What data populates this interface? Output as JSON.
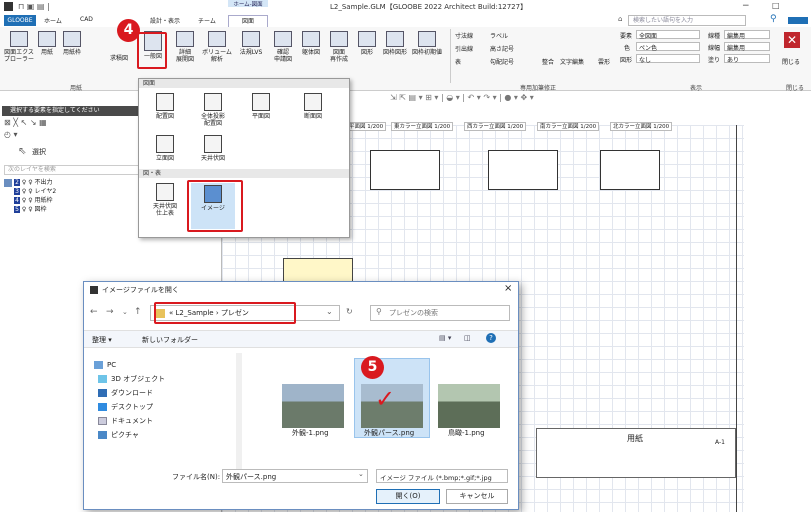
{
  "app": {
    "title": "L2_Sample.GLM【GLOOBE 2022 Architect Build:12727】",
    "context_tab": "ホーム-図面"
  },
  "tabs": [
    "GLOOBE",
    "ホーム",
    "CAD",
    "設計・表示",
    "チーム",
    "図面"
  ],
  "search": {
    "placeholder": "検索したい語句を入力"
  },
  "ribbon": {
    "buttons": [
      "図面エクス\nプローラー",
      "用紙",
      "用紙枠",
      "求積図",
      "一般図",
      "詳細\n展開図",
      "ボリューム\n解析",
      "法規LVS",
      "確認\n申請図",
      "躯体図",
      "図面\n再作成",
      "図形",
      "図枠図形",
      "図枠初期値"
    ],
    "group_labels": {
      "paper": "用紙",
      "annotation": "専用加筆修正",
      "display": "表示",
      "close": "閉じる"
    },
    "dims": [
      "寸法線",
      "ラベル",
      "引出線",
      "高さ記号",
      "表",
      "勾配記号",
      "整合",
      "文字編集",
      "雲形"
    ],
    "props": {
      "element_label": "要素",
      "element_value": "全図面",
      "color_label": "色",
      "color_value": "ペン色",
      "frame_label": "図形",
      "frame_value": "なし",
      "line_label": "線種",
      "line_value": "編集用",
      "linewidth_label": "線幅",
      "linewidth_value": "編集用",
      "fill_label": "塗り",
      "fill_value": "あり"
    },
    "close_label": "閉じる"
  },
  "left_panel": {
    "hint": "選択する要素を指定してください",
    "select_label": "選択",
    "layer_search": "次のレイヤを検索",
    "layers": [
      {
        "num": "2",
        "name": "不出力"
      },
      {
        "num": "3",
        "name": "レイヤ2"
      },
      {
        "num": "4",
        "name": "用紙枠"
      },
      {
        "num": "5",
        "name": "図枠"
      }
    ]
  },
  "menu": {
    "section1": "図面",
    "section2": "図・表",
    "items1": [
      "配置図",
      "全体投影\n配置図",
      "平面図",
      "断面図",
      "立面図",
      "天井伏図"
    ],
    "items2": [
      "天井伏図\n仕上表",
      "イメージ"
    ]
  },
  "sheet_tabs": [
    "平面図 1/200",
    "東カラー立面図 1/200",
    "西カラー立面図 1/200",
    "南カラー立面図 1/200",
    "北カラー立面図 1/200"
  ],
  "titleblock": {
    "label": "用紙",
    "code": "A-1"
  },
  "dialog": {
    "title": "イメージファイルを開く",
    "path": [
      "L2_Sample",
      "プレゼン"
    ],
    "search_placeholder": "プレゼンの検索",
    "organize": "整理 ▾",
    "new_folder": "新しいフォルダー",
    "nav": [
      "PC",
      "3D オブジェクト",
      "ダウンロード",
      "デスクトップ",
      "ドキュメント",
      "ピクチャ"
    ],
    "files": [
      "外観-1.png",
      "外観パース.png",
      "鳥瞰-1.png"
    ],
    "filename_label": "ファイル名(N):",
    "filename_value": "外観パース.png",
    "filter": "イメージ ファイル (*.bmp;*.gif;*.jpg",
    "open": "開く(O)",
    "cancel": "キャンセル"
  },
  "steps": {
    "step4": "4",
    "step5": "5"
  },
  "colors": {
    "accent": "#1f6fb5",
    "highlight": "#d9191f",
    "selected_bg": "#cde3f7"
  }
}
